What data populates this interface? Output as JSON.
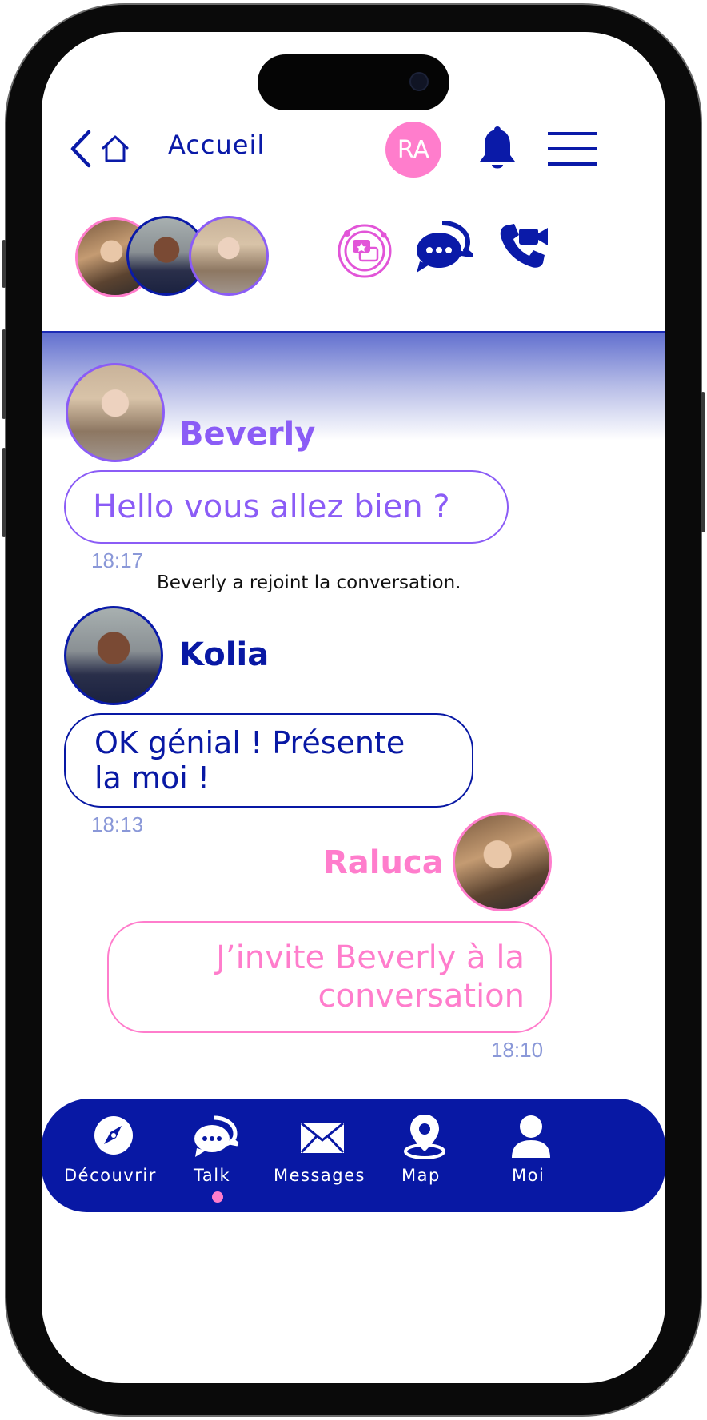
{
  "header": {
    "home_label": "Accueil",
    "user_initials": "RA"
  },
  "colors": {
    "primary": "#0818a4",
    "purple": "#8b5cf6",
    "pink": "#ff7dcc"
  },
  "messages": [
    {
      "sender": "Beverly",
      "text": "Hello vous allez bien ?",
      "time": "18:17",
      "color": "#8b5cf6"
    },
    {
      "system": "Beverly a rejoint la conversation."
    },
    {
      "sender": "Kolia",
      "text_line1": "OK génial ! Présente",
      "text_line2": "la moi !",
      "time": "18:13",
      "color": "#0818a4"
    },
    {
      "sender": "Raluca",
      "text_line1": "J’invite Beverly à la",
      "text_line2": "conversation",
      "time": "18:10",
      "color": "#ff7dcc"
    }
  ],
  "nav": [
    {
      "label": "Découvrir",
      "icon": "compass-icon"
    },
    {
      "label": "Talk",
      "icon": "chat-icon",
      "active": true
    },
    {
      "label": "Messages",
      "icon": "envelope-icon"
    },
    {
      "label": "Map",
      "icon": "map-pin-icon"
    },
    {
      "label": "Moi",
      "icon": "user-icon"
    }
  ]
}
